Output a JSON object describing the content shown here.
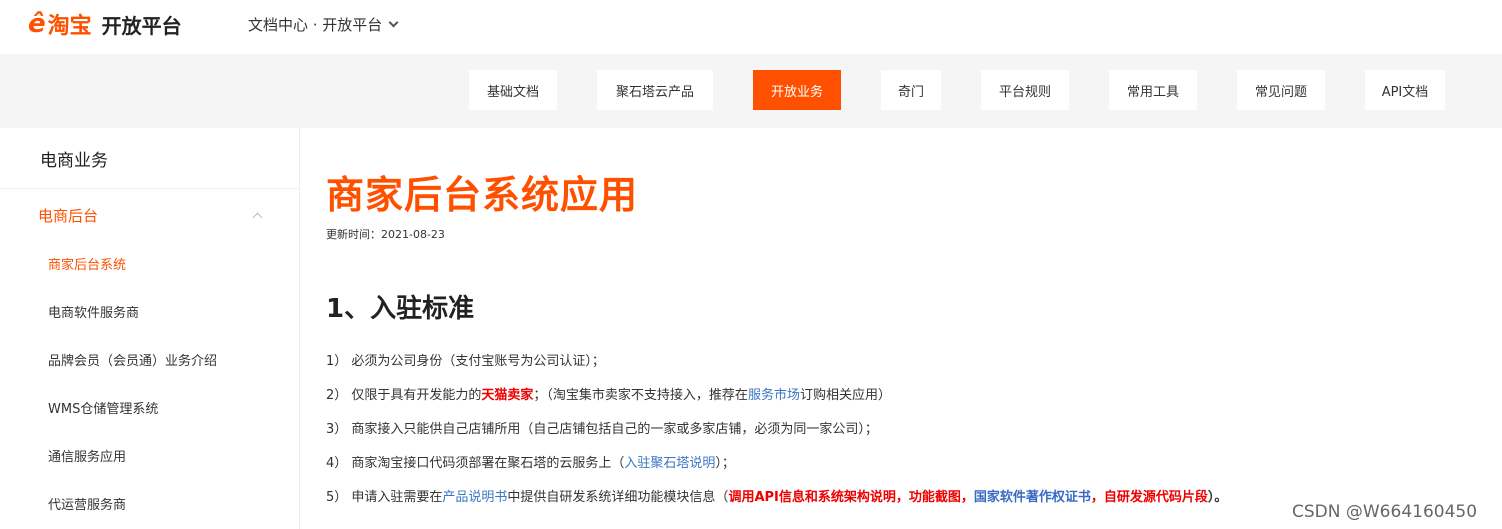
{
  "header": {
    "logo_mark": "ê",
    "logo_cn": "淘宝",
    "logo_sub": "开放平台",
    "doc_switch": "文档中心 · 开放平台"
  },
  "nav": [
    {
      "label": "基础文档"
    },
    {
      "label": "聚石塔云产品"
    },
    {
      "label": "开放业务",
      "active": true
    },
    {
      "label": "奇门"
    },
    {
      "label": "平台规则"
    },
    {
      "label": "常用工具"
    },
    {
      "label": "常见问题"
    },
    {
      "label": "API文档"
    }
  ],
  "sidebar": {
    "title": "电商业务",
    "group": "电商后台",
    "items": [
      {
        "label": "商家后台系统",
        "active": true
      },
      {
        "label": "电商软件服务商"
      },
      {
        "label": "品牌会员（会员通）业务介绍"
      },
      {
        "label": "WMS仓储管理系统"
      },
      {
        "label": "通信服务应用"
      },
      {
        "label": "代运营服务商"
      }
    ]
  },
  "main": {
    "title": "商家后台系统应用",
    "updated": "更新时间：2021-08-23",
    "section": "1、入驻标准",
    "p1": "1）  必须为公司身份（支付宝账号为公司认证）；",
    "p2_a": "2）  仅限于具有开发能力的",
    "p2_red": "天猫卖家",
    "p2_b": "；（淘宝集市卖家不支持接入，推荐在",
    "p2_link": "服务市场",
    "p2_c": "订购相关应用）",
    "p3": "3）  商家接入只能供自己店铺所用（自己店铺包括自己的一家或多家店铺，必须为同一家公司）；",
    "p4_a": "4）  商家淘宝接口代码须部署在聚石塔的云服务上（",
    "p4_link": "入驻聚石塔说明",
    "p4_b": "）；",
    "p5_a": "5）  申请入驻需要在",
    "p5_link": "产品说明书",
    "p5_b": "中提供自研发系统详细功能模块信息（",
    "p5_r1": "调用API信息和系统架构说明，功能截图，",
    "p5_b1": "国家软件著作权证书",
    "p5_r2": "，自研发源代码片段",
    "p5_end": "）。"
  },
  "watermark": "CSDN @W664160450"
}
